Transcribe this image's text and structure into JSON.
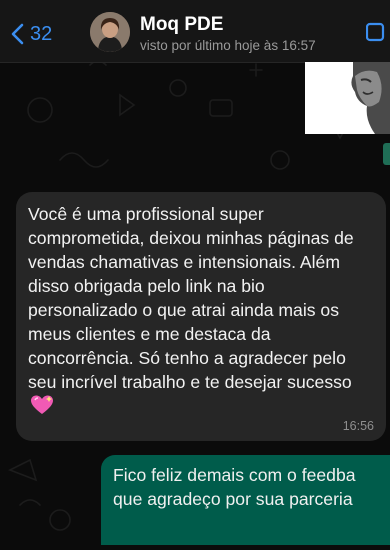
{
  "header": {
    "back_count": "32",
    "contact_name": "Moq PDE",
    "status": "visto por último hoje às 16:57"
  },
  "messages": {
    "incoming": {
      "text": "Você é uma profissional super comprometida, deixou minhas páginas de vendas chamativas e intensionais. Além disso obrigada pelo link na bio personalizado o que atrai ainda mais os meus clientes e me destaca da concorrência. Só tenho a agradecer pelo seu incrível trabalho e te desejar sucesso",
      "emoji": "sparkling-heart-icon",
      "time": "16:56"
    },
    "outgoing": {
      "line1": "Fico feliz demais com o feedba",
      "line2": "que agradeço por sua parceria"
    }
  },
  "colors": {
    "accent": "#3b8ef0",
    "incoming_bubble": "#262626",
    "outgoing_bubble": "#005c4b",
    "background": "#0b0b0b"
  }
}
